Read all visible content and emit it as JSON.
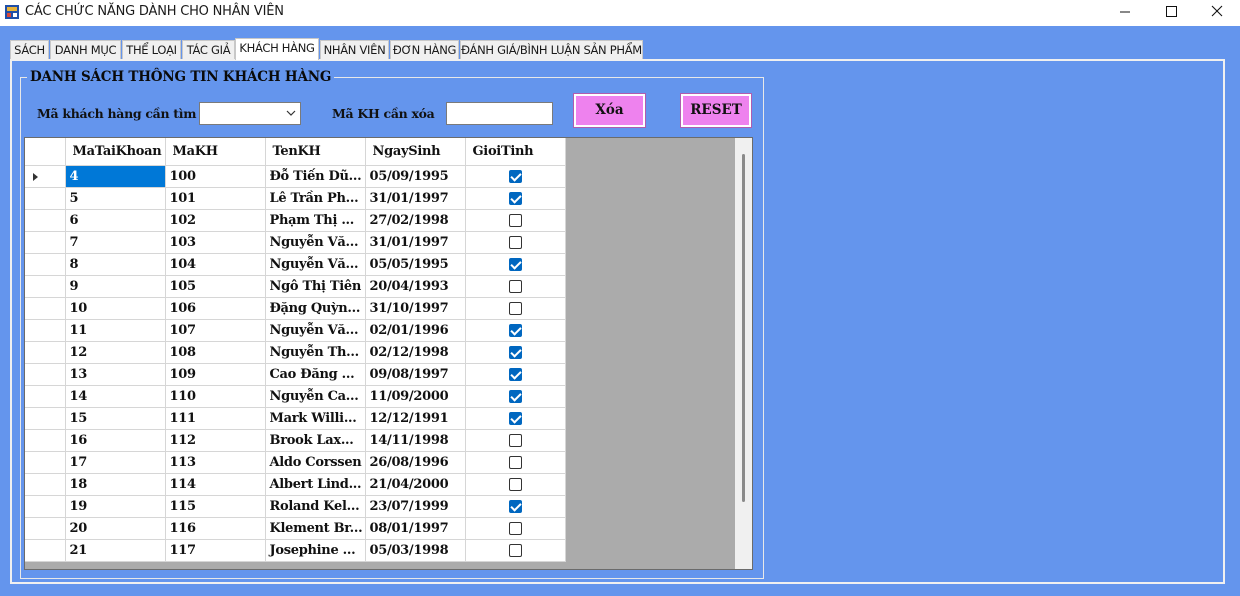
{
  "window": {
    "title": "CÁC CHỨC NĂNG DÀNH CHO NHÂN VIÊN"
  },
  "tabs": [
    {
      "label": "SÁCH",
      "active": false
    },
    {
      "label": "DANH MỤC",
      "active": false
    },
    {
      "label": "THỂ LOẠI",
      "active": false
    },
    {
      "label": "TÁC GIẢ",
      "active": false
    },
    {
      "label": "KHÁCH HÀNG",
      "active": true
    },
    {
      "label": "NHÂN VIÊN",
      "active": false
    },
    {
      "label": "ĐƠN HÀNG",
      "active": false
    },
    {
      "label": "ĐÁNH GIÁ/BÌNH LUẬN SẢN PHẨM",
      "active": false
    }
  ],
  "group": {
    "title": "DANH SÁCH THÔNG TIN KHÁCH HÀNG"
  },
  "search": {
    "label": "Mã khách hàng cần tìm",
    "value": ""
  },
  "delete_field": {
    "label": "Mã KH cần xóa",
    "value": ""
  },
  "buttons": {
    "delete_label": "Xóa",
    "reset_label": "RESET",
    "color": "#EE82EE"
  },
  "grid": {
    "columns": [
      "MaTaiKhoan",
      "MaKH",
      "TenKH",
      "NgaySinh",
      "GioiTinh"
    ],
    "rows": [
      {
        "ma_tk": "4",
        "ma_kh": "100",
        "ten": "Đỗ Tiến Dũ...",
        "ngay_sinh": "05/09/1995",
        "gioi_tinh": true
      },
      {
        "ma_tk": "5",
        "ma_kh": "101",
        "ten": "Lê Trần Ph...",
        "ngay_sinh": "31/01/1997",
        "gioi_tinh": true
      },
      {
        "ma_tk": "6",
        "ma_kh": "102",
        "ten": "Phạm Thị ...",
        "ngay_sinh": "27/02/1998",
        "gioi_tinh": false
      },
      {
        "ma_tk": "7",
        "ma_kh": "103",
        "ten": "Nguyễn Vă...",
        "ngay_sinh": "31/01/1997",
        "gioi_tinh": false
      },
      {
        "ma_tk": "8",
        "ma_kh": "104",
        "ten": "Nguyễn Vă...",
        "ngay_sinh": "05/05/1995",
        "gioi_tinh": true
      },
      {
        "ma_tk": "9",
        "ma_kh": "105",
        "ten": "Ngô Thị Tiên",
        "ngay_sinh": "20/04/1993",
        "gioi_tinh": false
      },
      {
        "ma_tk": "10",
        "ma_kh": "106",
        "ten": "Đặng Quỳn...",
        "ngay_sinh": "31/10/1997",
        "gioi_tinh": false
      },
      {
        "ma_tk": "11",
        "ma_kh": "107",
        "ten": "Nguyễn Vă...",
        "ngay_sinh": "02/01/1996",
        "gioi_tinh": true
      },
      {
        "ma_tk": "12",
        "ma_kh": "108",
        "ten": "Nguyễn Th...",
        "ngay_sinh": "02/12/1998",
        "gioi_tinh": true
      },
      {
        "ma_tk": "13",
        "ma_kh": "109",
        "ten": "Cao Đăng ...",
        "ngay_sinh": "09/08/1997",
        "gioi_tinh": true
      },
      {
        "ma_tk": "14",
        "ma_kh": "110",
        "ten": "Nguyễn Ca...",
        "ngay_sinh": "11/09/2000",
        "gioi_tinh": true
      },
      {
        "ma_tk": "15",
        "ma_kh": "111",
        "ten": "Mark Willi...",
        "ngay_sinh": "12/12/1991",
        "gioi_tinh": true
      },
      {
        "ma_tk": "16",
        "ma_kh": "112",
        "ten": "Brook Lax...",
        "ngay_sinh": "14/11/1998",
        "gioi_tinh": false
      },
      {
        "ma_tk": "17",
        "ma_kh": "113",
        "ten": "Aldo Corssen",
        "ngay_sinh": "26/08/1996",
        "gioi_tinh": false
      },
      {
        "ma_tk": "18",
        "ma_kh": "114",
        "ten": "Albert Lind...",
        "ngay_sinh": "21/04/2000",
        "gioi_tinh": false
      },
      {
        "ma_tk": "19",
        "ma_kh": "115",
        "ten": "Roland Kel...",
        "ngay_sinh": "23/07/1999",
        "gioi_tinh": true
      },
      {
        "ma_tk": "20",
        "ma_kh": "116",
        "ten": "Klement Br...",
        "ngay_sinh": "08/01/1997",
        "gioi_tinh": false
      },
      {
        "ma_tk": "21",
        "ma_kh": "117",
        "ten": "Josephine ...",
        "ngay_sinh": "05/03/1998",
        "gioi_tinh": false
      }
    ]
  },
  "colors": {
    "background": "#6495ED",
    "selection": "#0078D7",
    "checkbox_on": "#0067C0",
    "grid_empty": "#ABABAB"
  }
}
